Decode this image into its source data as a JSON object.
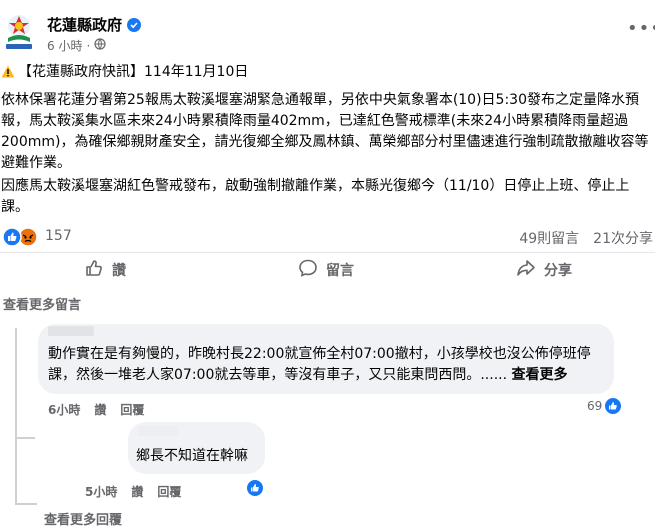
{
  "header": {
    "page_name": "花蓮縣政府",
    "timestamp": "6 小時",
    "separator": "·"
  },
  "post": {
    "title_line": "【花蓮縣政府快訊】114年11月10日",
    "paragraph_1": "依林保署花蓮分署第25報馬太鞍溪堰塞湖緊急通報單，另依中央氣象署本(10)日5:30發布之定量降水預報，馬太鞍溪集水區未來24小時累積降雨量402mm，已達紅色警戒標準(未來24小時累積降雨量超過200mm)，為確保鄉親財產安全，請光復鄉全鄉及鳳林鎮、萬榮鄉部分村里儘速進行強制疏散撤離收容等避難作業。",
    "paragraph_2": "因應馬太鞍溪堰塞湖紅色警戒發布，啟動強制撤離作業，本縣光復鄉今（11/10）日停止上班、停止上課。"
  },
  "reactions": {
    "count": "157",
    "comments": "49則留言",
    "shares": "21次分享",
    "icons": [
      "like-icon",
      "angry-icon"
    ]
  },
  "actions": {
    "like": "讚",
    "comment": "留言",
    "share": "分享"
  },
  "comments": {
    "view_more": "查看更多留言",
    "c1": {
      "text": "動作實在是有夠慢的，昨晚村長22:00就宣佈全村07:00撤村，小孩學校也沒公佈停班停課，然後一堆老人家07:00就去等車，等沒有車子，又只能東問西問。......",
      "see_more": "查看更多",
      "time": "6小時",
      "like": "讚",
      "reply": "回覆",
      "likes": "69"
    },
    "c2": {
      "text": "鄉長不知道在幹嘛",
      "time": "5小時",
      "like": "讚",
      "reply": "回覆"
    },
    "view_more_replies": "查看更多回覆"
  },
  "colors": {
    "accent": "#1877f2",
    "muted": "#65676b",
    "bubble": "#f0f2f5"
  }
}
